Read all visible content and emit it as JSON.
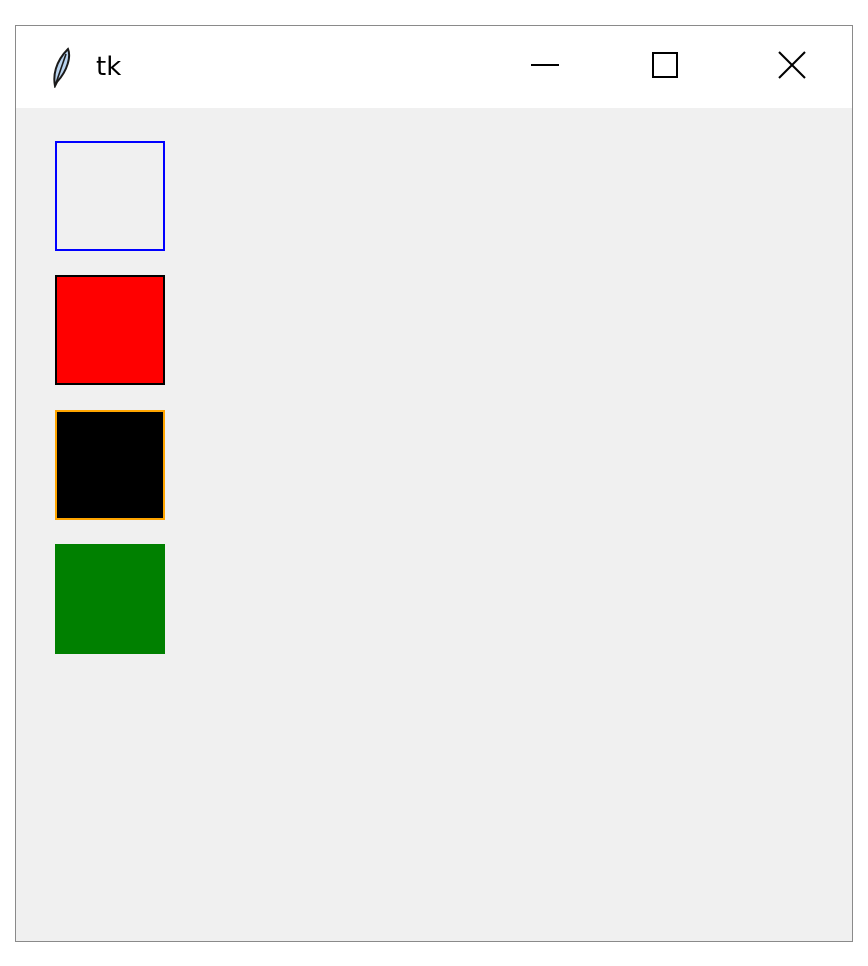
{
  "window": {
    "title": "tk",
    "app_icon": "feather-icon",
    "controls": [
      {
        "name": "minimize-button",
        "icon": "minimize-icon"
      },
      {
        "name": "maximize-button",
        "icon": "maximize-icon"
      },
      {
        "name": "close-button",
        "icon": "close-icon"
      }
    ]
  },
  "canvas": {
    "background": "#f0f0f0",
    "rectangles": [
      {
        "name": "blue-outline-square",
        "fill": "none",
        "outline": "#0000ff"
      },
      {
        "name": "red-square",
        "fill": "#ff0000",
        "outline": "#000000"
      },
      {
        "name": "black-square",
        "fill": "#000000",
        "outline": "#ffa500"
      },
      {
        "name": "green-square",
        "fill": "#008000",
        "outline": "none"
      }
    ]
  }
}
